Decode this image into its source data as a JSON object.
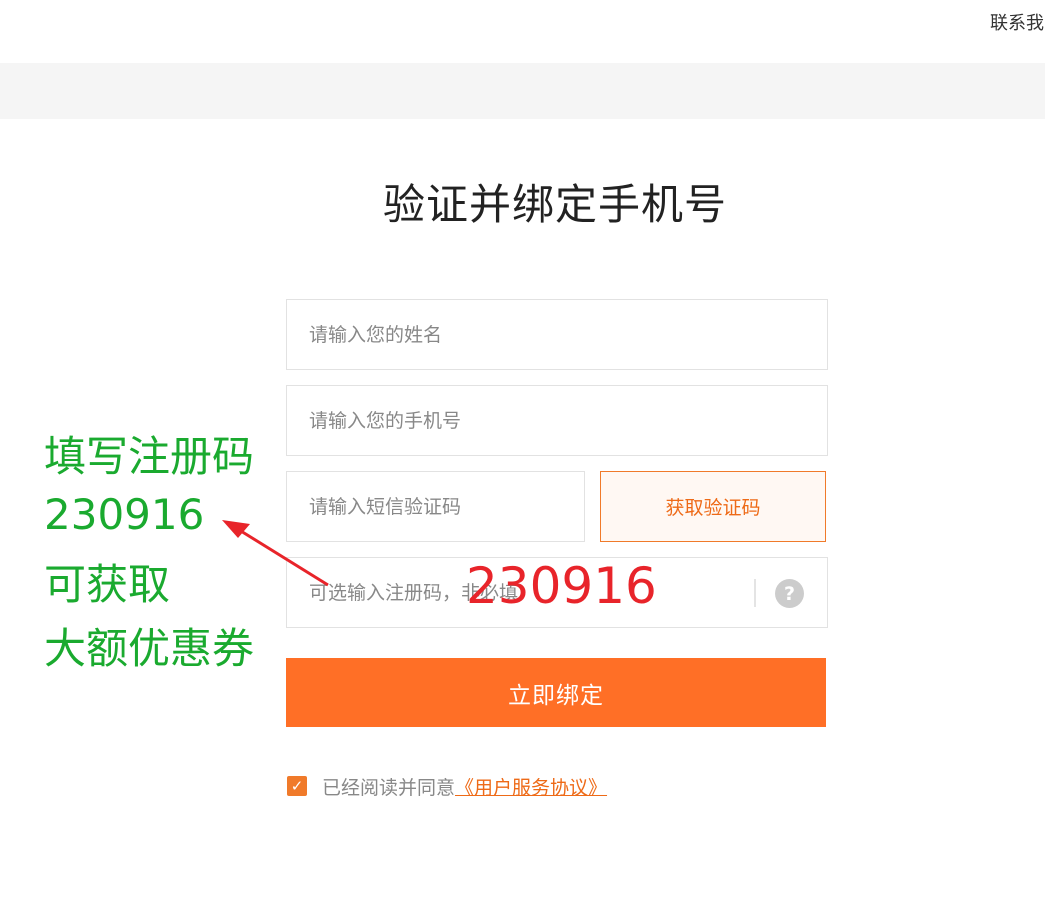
{
  "header": {
    "contact_link": "联系我"
  },
  "page": {
    "title": "验证并绑定手机号"
  },
  "form": {
    "name_placeholder": "请输入您的姓名",
    "phone_placeholder": "请输入您的手机号",
    "sms_placeholder": "请输入短信验证码",
    "get_code_label": "获取验证码",
    "register_code_placeholder": "可选输入注册码，非必填",
    "help_icon": "question-circle-icon",
    "submit_label": "立即绑定",
    "agree_prefix": "已经阅读并同意",
    "agree_link": "《用户服务协议》",
    "agree_checked": true
  },
  "annotations": {
    "green_lines": [
      "填写注册码",
      "230916",
      "可获取",
      "大额优惠券"
    ],
    "red_code": "230916"
  },
  "colors": {
    "accent": "#ff6f26",
    "accent_text": "#ee6a17",
    "annotation_green": "#1aaa2f",
    "annotation_red": "#e8242a"
  }
}
